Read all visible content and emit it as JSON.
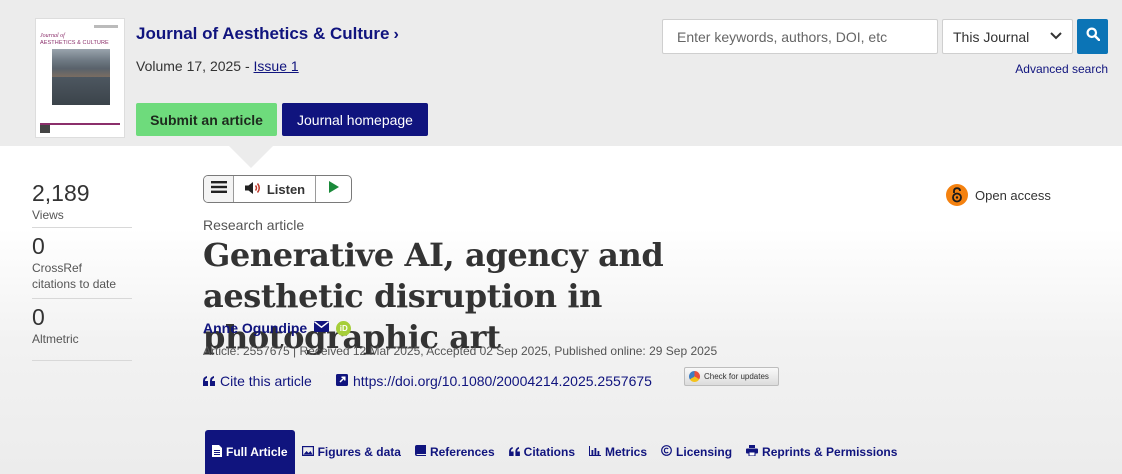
{
  "journal": {
    "cover_title_line1": "Journal of",
    "cover_title_line2": "AESTHETICS & CULTURE",
    "title": "Journal of Aesthetics & Culture",
    "volume_text": "Volume 17, 2025 - ",
    "issue_link": "Issue 1"
  },
  "header_buttons": {
    "submit": "Submit an article",
    "homepage": "Journal homepage"
  },
  "search": {
    "placeholder": "Enter keywords, authors, DOI, etc",
    "scope_selected": "This Journal",
    "advanced": "Advanced search"
  },
  "metrics": [
    {
      "value": "2,189",
      "label": "Views"
    },
    {
      "value": "0",
      "label_line1": "CrossRef",
      "label_line2": "citations to date"
    },
    {
      "value": "0",
      "label": "Altmetric"
    }
  ],
  "listen": {
    "label": "Listen"
  },
  "open_access": "Open access",
  "article": {
    "type": "Research article",
    "title": "Generative AI, agency and aesthetic disruption in photographic art",
    "author": "Anne Ogundipe",
    "orcid_label": "iD",
    "info": "Article: 2557675 | Received 12 Mar 2025, Accepted 02 Sep 2025, Published online: 29 Sep 2025",
    "cite": "Cite this article",
    "doi": "https://doi.org/10.1080/20004214.2025.2557675",
    "check_updates": "Check for updates"
  },
  "tabs": [
    {
      "label": "Full Article",
      "icon": "document-icon",
      "active": true
    },
    {
      "label": "Figures & data",
      "icon": "image-icon"
    },
    {
      "label": "References",
      "icon": "book-icon"
    },
    {
      "label": "Citations",
      "icon": "quote-icon"
    },
    {
      "label": "Metrics",
      "icon": "bar-chart-icon"
    },
    {
      "label": "Licensing",
      "icon": "copyright-icon"
    },
    {
      "label": "Reprints & Permissions",
      "icon": "printer-icon"
    }
  ],
  "colors": {
    "brand_navy": "#10147e",
    "submit_green": "#6edb7c",
    "search_blue": "#0b74b6",
    "open_access_orange": "#f4810f",
    "orcid_green": "#a6ce39"
  }
}
